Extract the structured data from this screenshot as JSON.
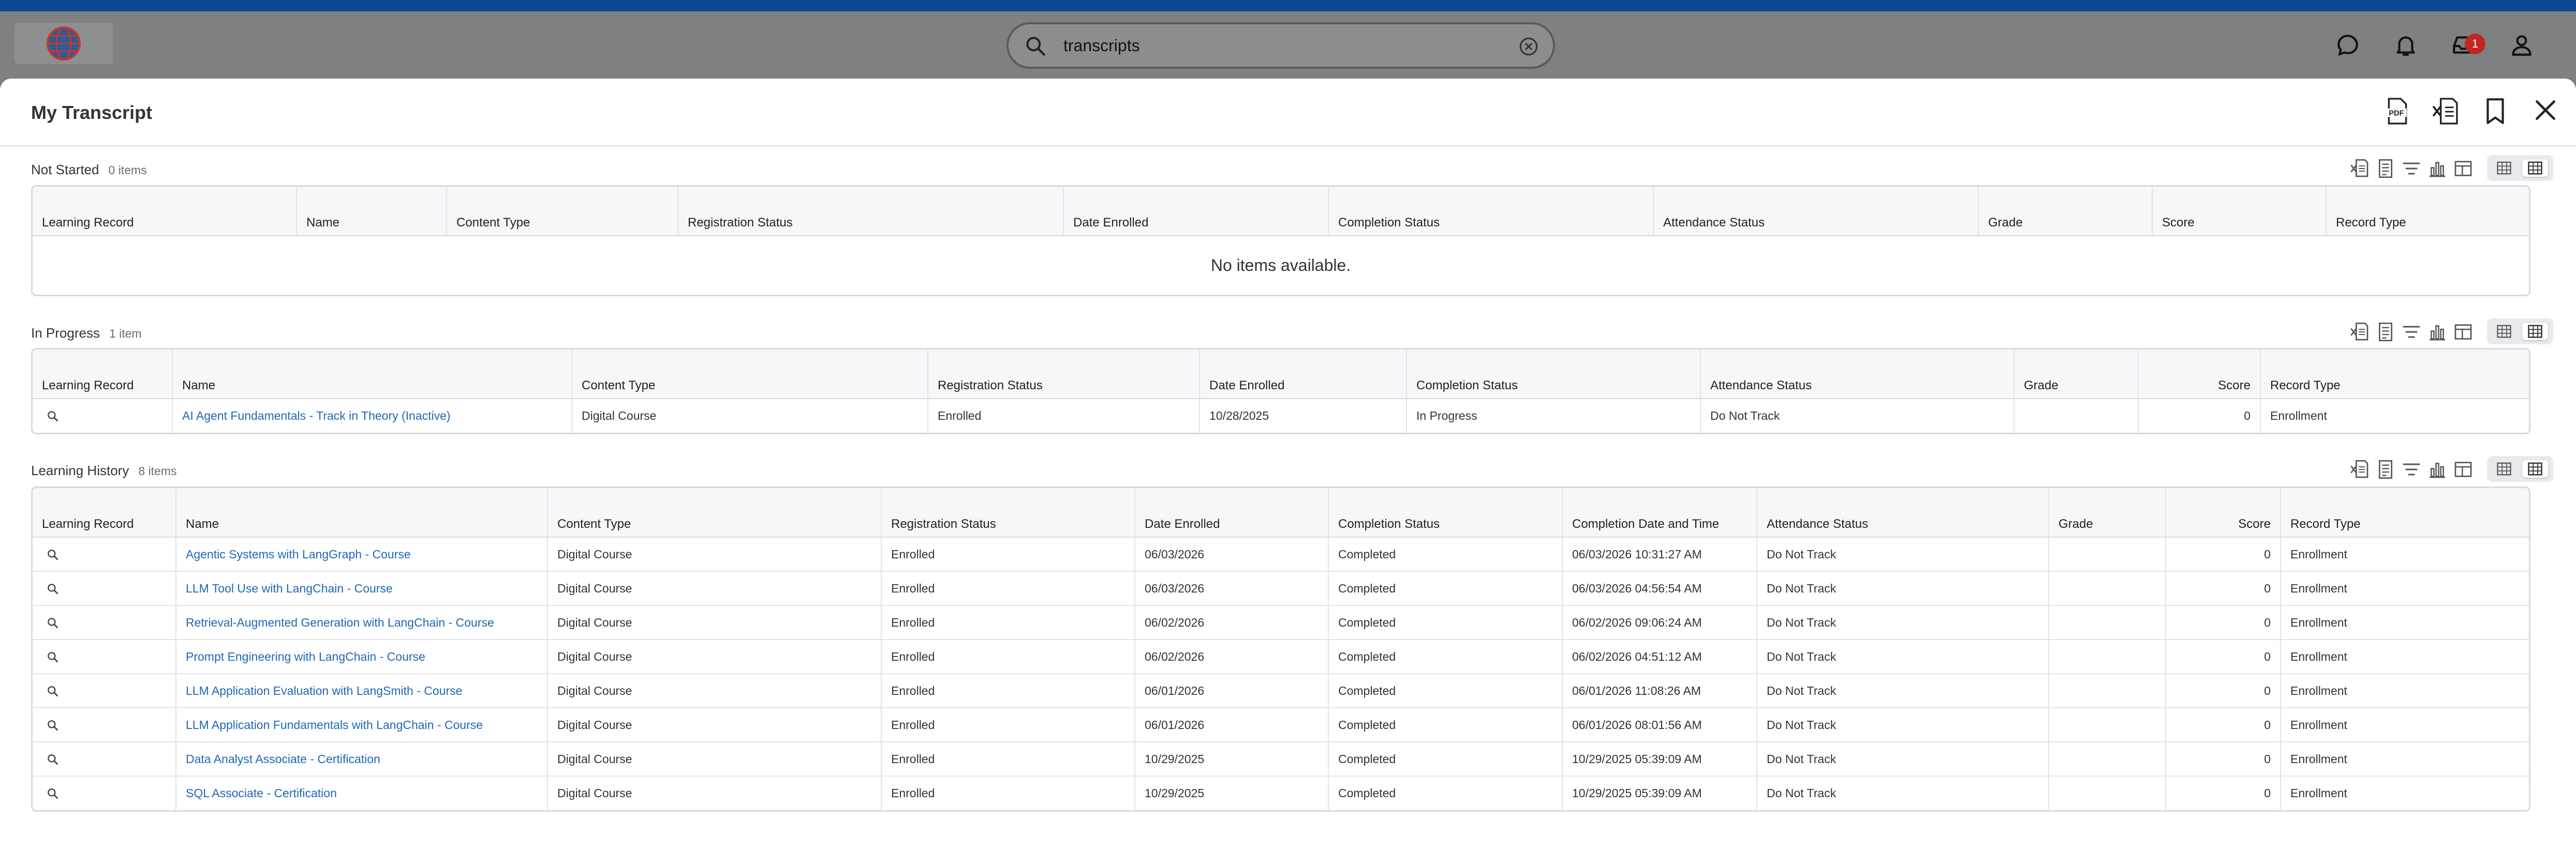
{
  "app": {
    "search": {
      "value": "transcripts",
      "placeholder": "Search"
    },
    "notification_count": "1"
  },
  "panel": {
    "title": "My Transcript"
  },
  "not_started": {
    "title": "Not Started",
    "count": "0 items",
    "columns": [
      "Learning Record",
      "Name",
      "Content Type",
      "Registration Status",
      "Date Enrolled",
      "Completion Status",
      "Attendance Status",
      "Grade",
      "Score",
      "Record Type"
    ],
    "empty_message": "No items available."
  },
  "in_progress": {
    "title": "In Progress",
    "count": "1 item",
    "columns": [
      "Learning Record",
      "Name",
      "Content Type",
      "Registration Status",
      "Date Enrolled",
      "Completion Status",
      "Attendance Status",
      "Grade",
      "Score",
      "Record Type"
    ],
    "rows": [
      {
        "name": "AI Agent Fundamentals - Track in Theory (Inactive)",
        "content_type": "Digital Course",
        "registration_status": "Enrolled",
        "date_enrolled": "10/28/2025",
        "completion_status": "In Progress",
        "attendance_status": "Do Not Track",
        "grade": "",
        "score": "0",
        "record_type": "Enrollment"
      }
    ]
  },
  "learning_history": {
    "title": "Learning History",
    "count": "8 items",
    "columns": [
      "Learning Record",
      "Name",
      "Content Type",
      "Registration Status",
      "Date Enrolled",
      "Completion Status",
      "Completion Date and Time",
      "Attendance Status",
      "Grade",
      "Score",
      "Record Type"
    ],
    "rows": [
      {
        "name": "Agentic Systems with LangGraph - Course",
        "content_type": "Digital Course",
        "registration_status": "Enrolled",
        "date_enrolled": "06/03/2026",
        "completion_status": "Completed",
        "completion_datetime": "06/03/2026 10:31:27 AM",
        "attendance_status": "Do Not Track",
        "grade": "",
        "score": "0",
        "record_type": "Enrollment"
      },
      {
        "name": "LLM Tool Use with LangChain - Course",
        "content_type": "Digital Course",
        "registration_status": "Enrolled",
        "date_enrolled": "06/03/2026",
        "completion_status": "Completed",
        "completion_datetime": "06/03/2026 04:56:54 AM",
        "attendance_status": "Do Not Track",
        "grade": "",
        "score": "0",
        "record_type": "Enrollment"
      },
      {
        "name": "Retrieval-Augmented Generation with LangChain - Course",
        "content_type": "Digital Course",
        "registration_status": "Enrolled",
        "date_enrolled": "06/02/2026",
        "completion_status": "Completed",
        "completion_datetime": "06/02/2026 09:06:24 AM",
        "attendance_status": "Do Not Track",
        "grade": "",
        "score": "0",
        "record_type": "Enrollment"
      },
      {
        "name": "Prompt Engineering with LangChain - Course",
        "content_type": "Digital Course",
        "registration_status": "Enrolled",
        "date_enrolled": "06/02/2026",
        "completion_status": "Completed",
        "completion_datetime": "06/02/2026 04:51:12 AM",
        "attendance_status": "Do Not Track",
        "grade": "",
        "score": "0",
        "record_type": "Enrollment"
      },
      {
        "name": "LLM Application Evaluation with LangSmith - Course",
        "content_type": "Digital Course",
        "registration_status": "Enrolled",
        "date_enrolled": "06/01/2026",
        "completion_status": "Completed",
        "completion_datetime": "06/01/2026 11:08:26 AM",
        "attendance_status": "Do Not Track",
        "grade": "",
        "score": "0",
        "record_type": "Enrollment"
      },
      {
        "name": "LLM Application Fundamentals with LangChain - Course",
        "content_type": "Digital Course",
        "registration_status": "Enrolled",
        "date_enrolled": "06/01/2026",
        "completion_status": "Completed",
        "completion_datetime": "06/01/2026 08:01:56 AM",
        "attendance_status": "Do Not Track",
        "grade": "",
        "score": "0",
        "record_type": "Enrollment"
      },
      {
        "name": "Data Analyst Associate - Certification",
        "content_type": "Digital Course",
        "registration_status": "Enrolled",
        "date_enrolled": "10/29/2025",
        "completion_status": "Completed",
        "completion_datetime": "10/29/2025 05:39:09 AM",
        "attendance_status": "Do Not Track",
        "grade": "",
        "score": "0",
        "record_type": "Enrollment"
      },
      {
        "name": "SQL Associate - Certification",
        "content_type": "Digital Course",
        "registration_status": "Enrolled",
        "date_enrolled": "10/29/2025",
        "completion_status": "Completed",
        "completion_datetime": "10/29/2025 05:39:09 AM",
        "attendance_status": "Do Not Track",
        "grade": "",
        "score": "0",
        "record_type": "Enrollment"
      }
    ]
  },
  "icons": {
    "logo": "globe-logo-icon",
    "search": "search-icon",
    "clear": "clear-circle-icon",
    "chat": "chat-icon",
    "bell": "bell-icon",
    "inbox": "inbox-icon",
    "profile": "profile-icon",
    "pdf": "pdf-export-icon",
    "excel": "excel-export-icon",
    "bookmark": "bookmark-icon",
    "close": "close-icon",
    "row_action": "magnifier-icon"
  },
  "colors": {
    "brand_bar": "#0b4a93",
    "link": "#1f67b5",
    "badge": "#c0281f"
  }
}
